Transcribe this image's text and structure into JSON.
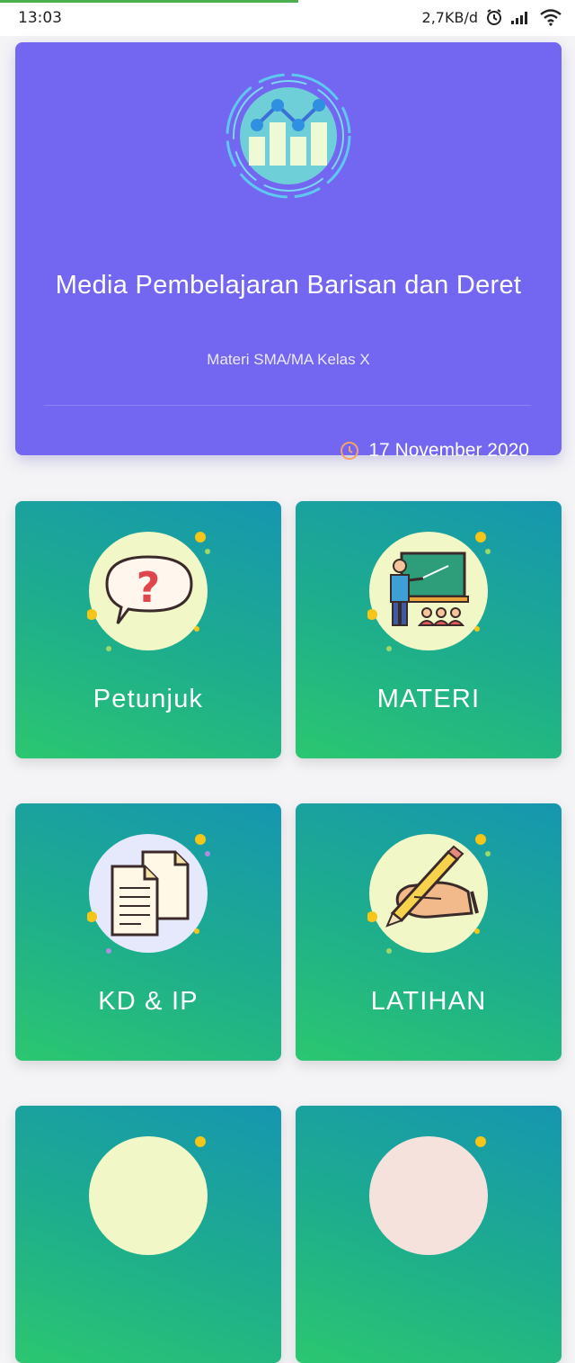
{
  "status_bar": {
    "time": "13:03",
    "network_speed": "2,7KB/d",
    "icons": [
      "alarm-icon",
      "signal-icon",
      "wifi-icon"
    ]
  },
  "header_card": {
    "icon": "chart-logo-icon",
    "title": "Media Pembelajaran Barisan dan Deret",
    "subtitle": "Materi SMA/MA Kelas X",
    "date": "17 November 2020",
    "colors": {
      "background": "#7366f0",
      "clock": "#f5a26a"
    }
  },
  "menu": [
    {
      "label": "Petunjuk",
      "icon": "question-bubble-icon"
    },
    {
      "label": "MATERI",
      "icon": "teacher-board-icon"
    },
    {
      "label": "KD & IP",
      "icon": "documents-icon"
    },
    {
      "label": "LATIHAN",
      "icon": "hand-writing-icon"
    }
  ],
  "colors": {
    "card_gradient_top": "#1696b0",
    "card_gradient_bottom": "#2bc770",
    "accent_dot": "#f5c518"
  }
}
